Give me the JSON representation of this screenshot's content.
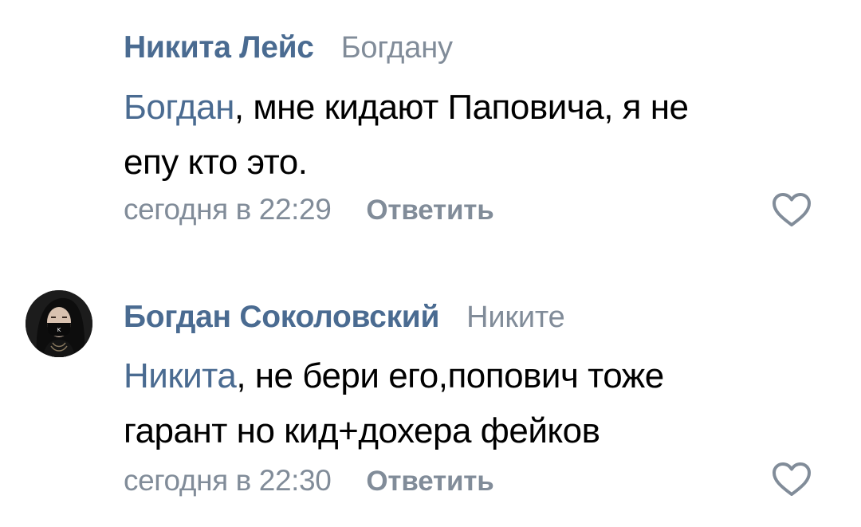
{
  "comments": [
    {
      "author": "Никита Лейс",
      "reply_to": "Богдану",
      "mention": "Богдан",
      "text_line1_rest": ", мне кидают Паповича, я не",
      "text_line2": "епу кто это.",
      "timestamp": "сегодня в 22:29",
      "reply_label": "Ответить",
      "like_icon": "heart-outline-icon"
    },
    {
      "author": "Богдан Соколовский",
      "reply_to": "Никите",
      "mention": "Никита",
      "text_line1_rest": ", не бери его,попович тоже",
      "text_line2": "гарант но кид+дохера фейков",
      "timestamp": "сегодня в 22:30",
      "reply_label": "Ответить",
      "like_icon": "heart-outline-icon",
      "avatar_icon": "masked-person-avatar"
    }
  ],
  "colors": {
    "author": "#4a6b91",
    "secondary": "#818c99",
    "text": "#000000",
    "background": "#ffffff"
  }
}
